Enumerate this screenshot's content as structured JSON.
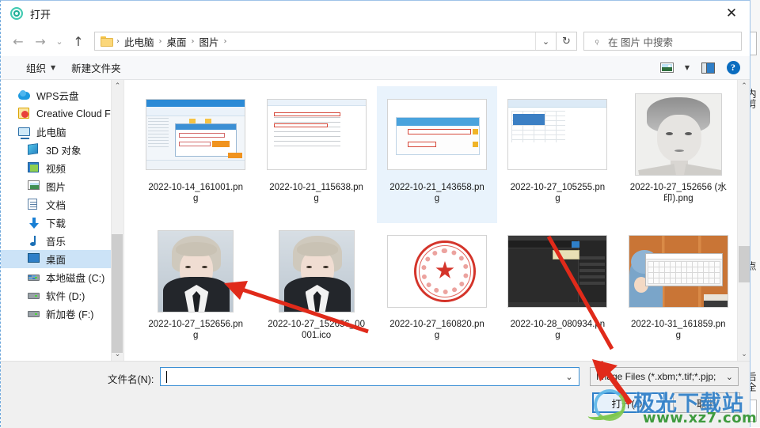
{
  "dialog": {
    "title": "打开",
    "title_icon": "target-ring-icon",
    "close_label": "✕"
  },
  "nav": {
    "back": "←",
    "forward": "→",
    "recent": "⌄",
    "up": "↑",
    "breadcrumbs": [
      "此电脑",
      "桌面",
      "图片"
    ],
    "separator": "›",
    "dropdown_caret": "⌄",
    "refresh": "↻"
  },
  "search": {
    "icon": "search-icon",
    "placeholder": "在 图片 中搜索"
  },
  "commandbar": {
    "organize": "组织",
    "organize_caret": "▼",
    "new_folder": "新建文件夹",
    "view_icon": "picture-view-icon",
    "view_caret": "▼",
    "pane_icon": "preview-pane-icon",
    "help_icon": "help-icon",
    "help_glyph": "?"
  },
  "sidebar": {
    "scroll_up": "⌃",
    "scroll_down": "⌄",
    "items": [
      {
        "label": "WPS云盘",
        "icon": "cloud-icon",
        "indent": false,
        "selected": false
      },
      {
        "label": "Creative Cloud Fi",
        "icon": "creative-cloud-icon",
        "indent": false,
        "selected": false
      },
      {
        "label": "此电脑",
        "icon": "this-pc-icon",
        "indent": false,
        "selected": false
      },
      {
        "label": "3D 对象",
        "icon": "3d-objects-icon",
        "indent": true,
        "selected": false
      },
      {
        "label": "视频",
        "icon": "videos-icon",
        "indent": true,
        "selected": false
      },
      {
        "label": "图片",
        "icon": "pictures-icon",
        "indent": true,
        "selected": false
      },
      {
        "label": "文档",
        "icon": "documents-icon",
        "indent": true,
        "selected": false
      },
      {
        "label": "下载",
        "icon": "downloads-icon",
        "indent": true,
        "selected": false
      },
      {
        "label": "音乐",
        "icon": "music-icon",
        "indent": true,
        "selected": false
      },
      {
        "label": "桌面",
        "icon": "desktop-icon",
        "indent": true,
        "selected": true
      },
      {
        "label": "本地磁盘 (C:)",
        "icon": "local-disk-icon",
        "indent": true,
        "selected": false
      },
      {
        "label": "软件 (D:)",
        "icon": "drive-icon",
        "indent": true,
        "selected": false
      },
      {
        "label": "新加卷 (F:)",
        "icon": "drive-icon",
        "indent": true,
        "selected": false
      }
    ]
  },
  "filelist": {
    "scroll_up": "⌃",
    "scroll_down": "⌄",
    "files": [
      {
        "name": "2022-10-14_161001.png",
        "thumb": "screenshot-window",
        "selected": false
      },
      {
        "name": "2022-10-21_115638.png",
        "thumb": "screenshot-document",
        "selected": false
      },
      {
        "name": "2022-10-21_143658.png",
        "thumb": "screenshot-download-dialog",
        "selected": true
      },
      {
        "name": "2022-10-27_105255.png",
        "thumb": "screenshot-spreadsheet",
        "selected": false
      },
      {
        "name": "2022-10-27_152656 (水印).png",
        "thumb": "pencil-sketch-portrait",
        "selected": false
      },
      {
        "name": "2022-10-27_152656.png",
        "thumb": "id-photo-portrait",
        "selected": false
      },
      {
        "name": "2022-10-27_152656_00001.ico",
        "thumb": "id-photo-portrait",
        "selected": false
      },
      {
        "name": "2022-10-27_160820.png",
        "thumb": "red-official-seal",
        "selected": false
      },
      {
        "name": "2022-10-28_080934.png",
        "thumb": "dark-editor-window",
        "selected": false
      },
      {
        "name": "2022-10-31_161859.png",
        "thumb": "on-screen-keyboard",
        "selected": false
      }
    ]
  },
  "bottom": {
    "filename_label": "文件名(N):",
    "filename_value": "",
    "filename_dropdown_caret": "⌄",
    "filter_value": "Image Files (*.xbm;*.tif;*.pjp;",
    "filter_caret": "⌄",
    "open_button": "打开(O)",
    "cancel_button": "取消"
  },
  "watermark": {
    "text": "极光下载站",
    "url": "www.xz7.com",
    "logo": "aurora-logo"
  },
  "background_window": {
    "vertical_texts": [
      "内剪",
      "点",
      "后全"
    ]
  },
  "colors": {
    "accent": "#2f7fc8",
    "selection": "#cce3f7",
    "file_selection": "#e9f3fc",
    "annotation_arrow": "#e02a1a",
    "watermark_blue": "#2f7fc8",
    "watermark_green": "#3f9b3f"
  }
}
